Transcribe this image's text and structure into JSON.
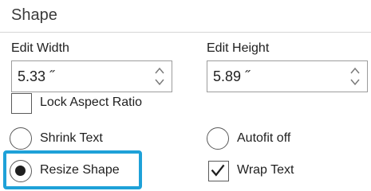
{
  "section": {
    "title": "Shape"
  },
  "width": {
    "label": "Edit Width",
    "value": "5.33 ˝"
  },
  "height": {
    "label": "Edit Height",
    "value": "5.89 ˝"
  },
  "lock_aspect": {
    "label": "Lock Aspect Ratio",
    "checked": false
  },
  "shrink_text": {
    "label": "Shrink Text",
    "selected": false
  },
  "autofit_off": {
    "label": "Autofit off",
    "selected": false
  },
  "resize_shape": {
    "label": "Resize Shape",
    "selected": true
  },
  "wrap_text": {
    "label": "Wrap Text",
    "checked": true
  },
  "colors": {
    "highlight": "#1ea1d8"
  }
}
